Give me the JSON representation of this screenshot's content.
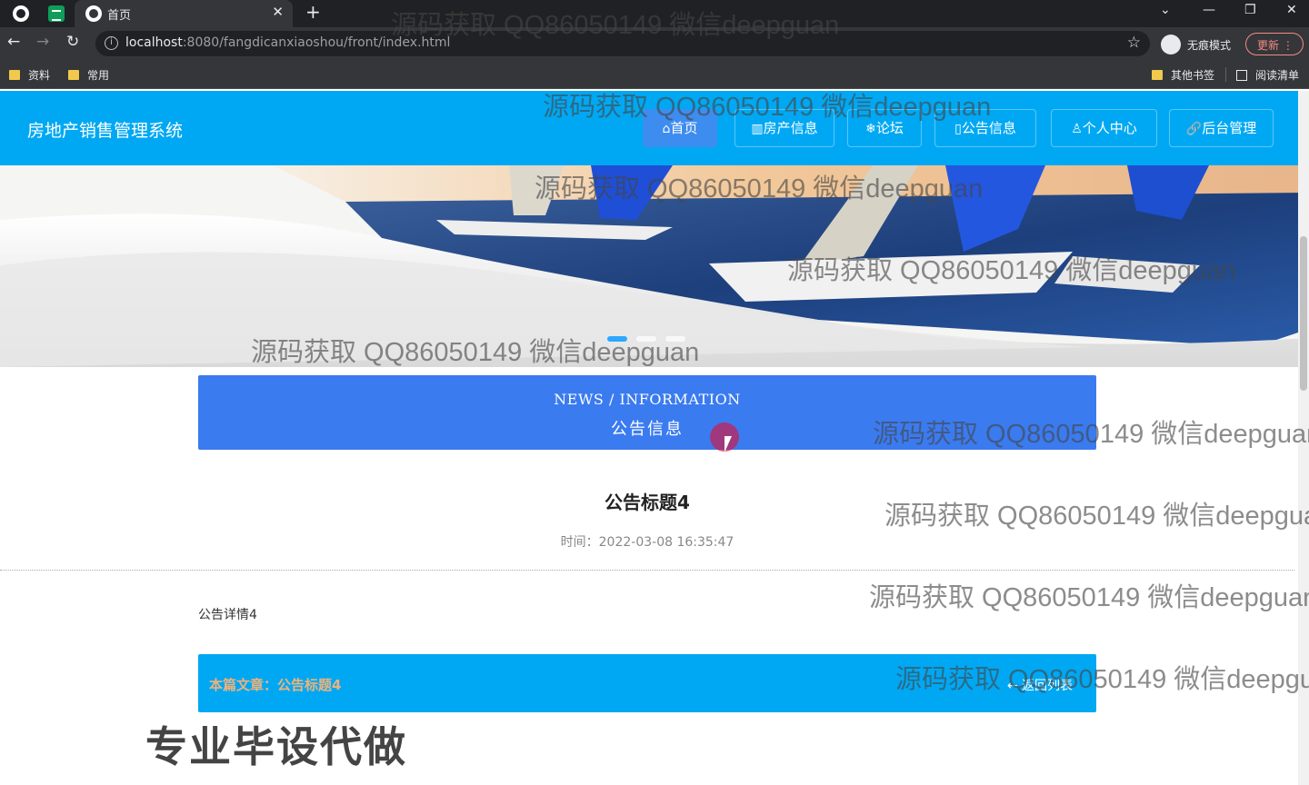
{
  "browser": {
    "tab_title": "首页",
    "url_host": "localhost",
    "url_rest": ":8080/fangdicanxiaoshou/front/index.html",
    "incognito_label": "无痕模式",
    "update_label": "更新",
    "bookmarks": [
      "资料",
      "常用"
    ],
    "bookmarks_right": [
      "其他书签",
      "阅读清单"
    ]
  },
  "site": {
    "title": "房地产销售管理系统",
    "nav": [
      "首页",
      "房产信息",
      "论坛",
      "公告信息",
      "个人中心",
      "后台管理"
    ],
    "nav_icons": [
      "home-icon",
      "building-icon",
      "snowflake-icon",
      "document-icon",
      "user-icon",
      "link-icon"
    ],
    "nav_glyphs": [
      "⌂",
      "▥",
      "❄",
      "▯",
      "♙",
      "🔗"
    ]
  },
  "section": {
    "en": "NEWS / INFORMATION",
    "cn": "公告信息"
  },
  "article": {
    "title": "公告标题4",
    "time_label": "时间：",
    "time": "2022-03-08 16:35:47",
    "body": "公告详情4",
    "current_label": "本篇文章：",
    "current_title": "公告标题4",
    "back_label": "返回列表"
  },
  "watermark": "源码获取 QQ86050149 微信deepguan",
  "promo": "专业毕设代做",
  "colors": {
    "header": "#00a8f3",
    "nav_active": "#3d8cf0",
    "news_box": "#3b7bf0"
  }
}
